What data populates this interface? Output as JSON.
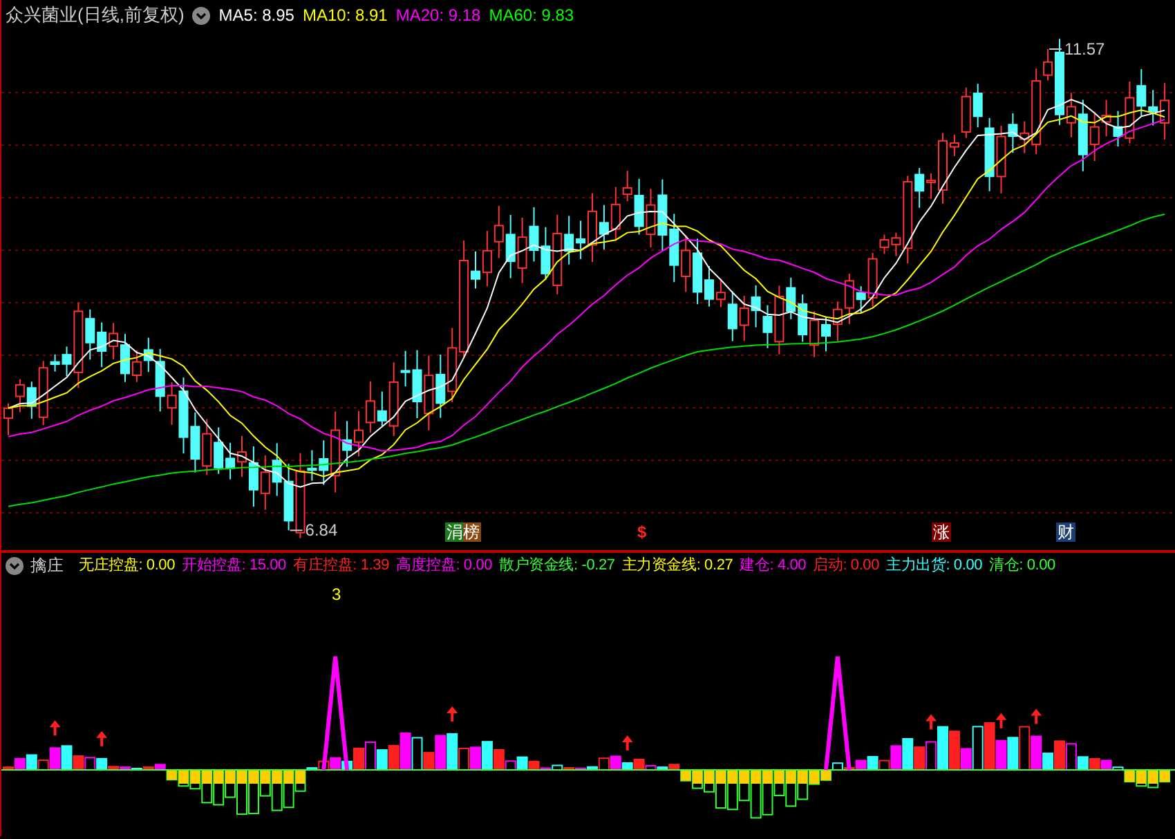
{
  "main_chart": {
    "title": "众兴菌业(日线,前复权)",
    "indicators": [
      {
        "label": "MA5: 8.95",
        "color": "#ffffff"
      },
      {
        "label": "MA10: 8.91",
        "color": "#ffff00"
      },
      {
        "label": "MA20: 9.18",
        "color": "#ff00ff"
      },
      {
        "label": "MA60: 9.83",
        "color": "#00ff00"
      }
    ],
    "high_label": "11.57",
    "low_label": "6.84",
    "markers": [
      {
        "kind": "badge",
        "text": "涓榜"
      },
      {
        "kind": "dollar",
        "text": "$"
      },
      {
        "kind": "tag",
        "text": "涨",
        "color": "#800000"
      },
      {
        "kind": "tag",
        "text": "财",
        "color": "#1c3f73"
      }
    ]
  },
  "sub_chart": {
    "title": "擒庄",
    "note": "3",
    "indicators": [
      {
        "label": "无庄控盘: 0.00",
        "color": "#ffff00"
      },
      {
        "label": "开始控盘: 15.00",
        "color": "#ff00ff"
      },
      {
        "label": "有庄控盘: 1.39",
        "color": "#ff2020"
      },
      {
        "label": "高度控盘: 0.00",
        "color": "#ff00ff"
      },
      {
        "label": "散户资金线: -0.27",
        "color": "#33ff33"
      },
      {
        "label": "主力资金线: 0.27",
        "color": "#ffff00"
      },
      {
        "label": "建仓: 4.00",
        "color": "#ff00ff"
      },
      {
        "label": "启动: 0.00",
        "color": "#ff2020"
      },
      {
        "label": "主力出货: 0.00",
        "color": "#33ffff"
      },
      {
        "label": "清仓: 0.00",
        "color": "#33ff33"
      }
    ]
  }
}
